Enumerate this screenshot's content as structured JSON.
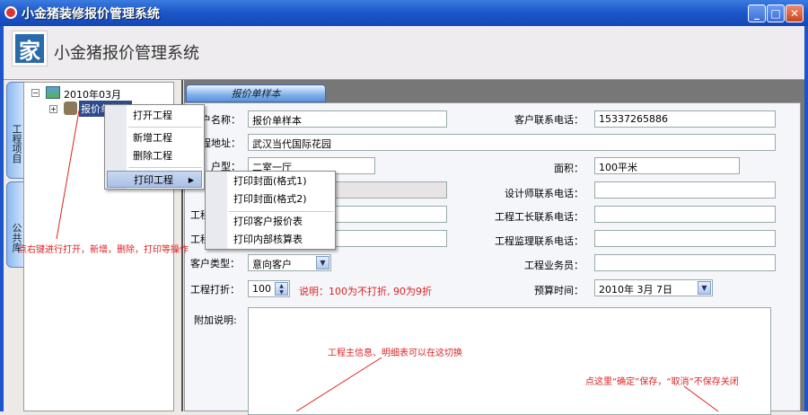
{
  "window": {
    "title": "小金猪装修报价管理系统",
    "minimize": "_",
    "maximize": "□",
    "close": "✕"
  },
  "header": {
    "logo": "家",
    "app_title": "小金猪报价管理系统"
  },
  "side_tabs": [
    "工程项目",
    "公共库"
  ],
  "tree": {
    "root": "2010年03月",
    "child": "报价单样本",
    "expand_root": "−",
    "expand_child": "+"
  },
  "tab": {
    "label": "报价单样本"
  },
  "context_menu": {
    "items": [
      "打开工程",
      "新增工程",
      "删除工程",
      "打印工程"
    ],
    "submenu_arrow": "▶"
  },
  "submenu": {
    "items": [
      "打印封面(格式1)",
      "打印封面(格式2)",
      "打印客户报价表",
      "打印内部核算表"
    ]
  },
  "form": {
    "customer_name_label": "客户名称：",
    "customer_name": "报价单样本",
    "customer_phone_label": "客户联系电话：",
    "customer_phone": "15337265886",
    "address_label": "工程地址：",
    "address": "武汉当代国际花园",
    "house_type_label": "户型：",
    "house_type": "二室一厅",
    "area_label": "面积：",
    "area": "100平米",
    "designer_phone_label": "设计师联系电话：",
    "row5_label": "工程",
    "foreman_phone_label": "工程工长联系电话：",
    "row6_label": "工程",
    "supervisor_phone_label": "工程监理联系电话：",
    "customer_type_label": "客户类型：",
    "customer_type": "意向客户",
    "salesman_label": "工程业务员：",
    "discount_label": "工程打折：",
    "discount": "100",
    "discount_note": "说明：100为不打折, 90为9折",
    "budget_time_label": "预算时间：",
    "budget_time": "2010年  3月  7日",
    "memo_label": "附加说明:"
  },
  "annotations": {
    "right_click": "点右键进行打开，新增，删除，打印等操作",
    "switch": "工程主信息、明细表可以在这切换",
    "save": "点这里“确定”保存，“取消”不保存关闭"
  }
}
